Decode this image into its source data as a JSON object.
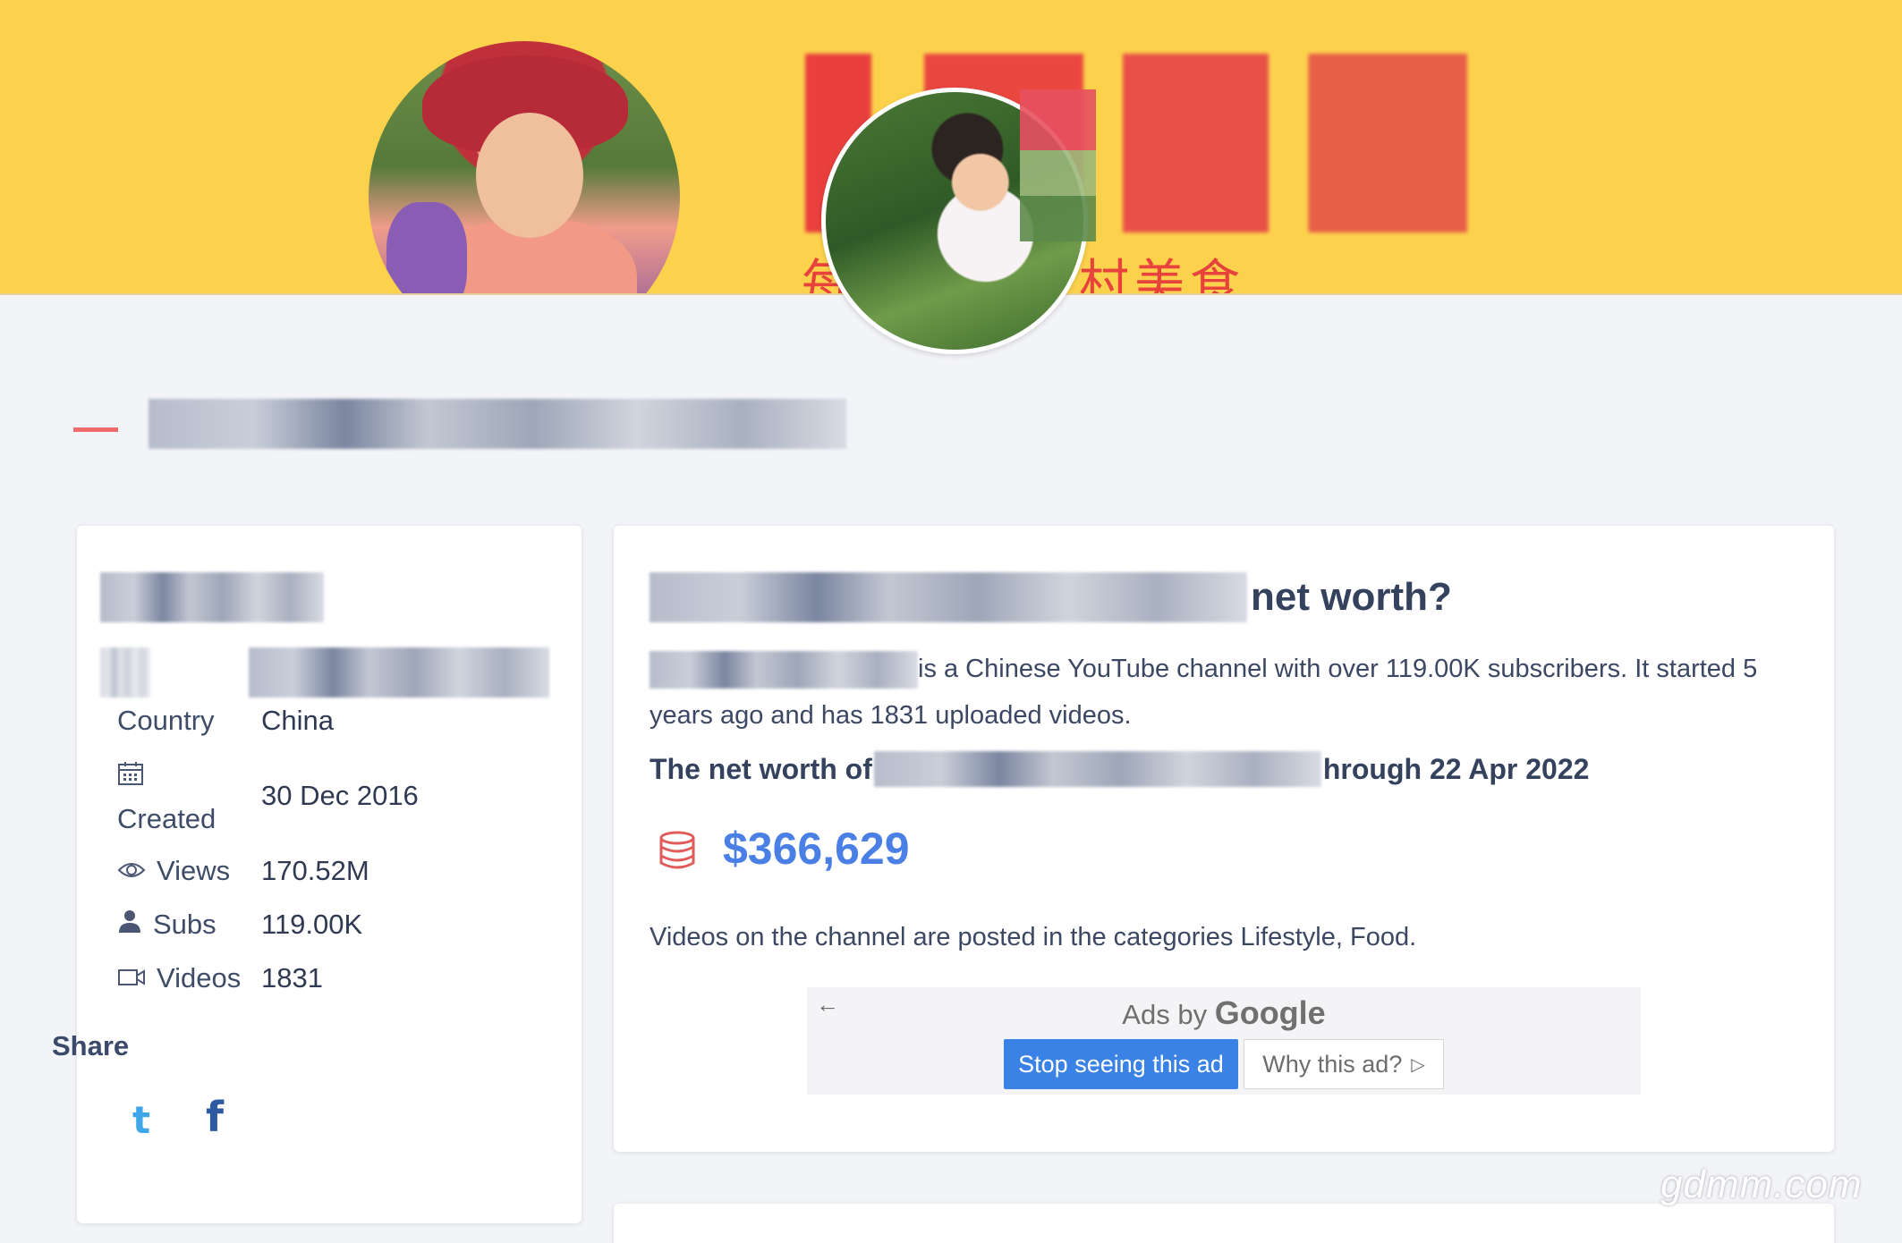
{
  "banner": {
    "subtitle": "每一样的农村美食"
  },
  "stats": {
    "country": {
      "label": "Country",
      "value": "China"
    },
    "created": {
      "label": "Created",
      "value": "30 Dec 2016"
    },
    "views": {
      "label": "Views",
      "value": "170.52M"
    },
    "subs": {
      "label": "Subs",
      "value": "119.00K"
    },
    "videos": {
      "label": "Videos",
      "value": "1831"
    }
  },
  "share": {
    "title": "Share"
  },
  "main": {
    "heading_suffix": "net worth?",
    "intro": "is a Chinese YouTube channel with over 119.00K subscribers. It started 5 years ago and has 1831 uploaded videos.",
    "networth_prefix": "The net worth of",
    "networth_suffix": "hrough 22 Apr 2022",
    "networth_value": "$366,629",
    "categories": "Videos on the channel are posted in the categories Lifestyle, Food."
  },
  "ad": {
    "ads_by": "Ads by",
    "google": "Google",
    "stop_label": "Stop seeing this ad",
    "why_label": "Why this ad?"
  },
  "watermark": "gdmm.com",
  "colors": {
    "banner": "#fcd24d",
    "accent_blue": "#4a80e6",
    "accent_red": "#ee6c6c",
    "twitter": "#3fa6e8",
    "facebook": "#2f5aa2"
  }
}
